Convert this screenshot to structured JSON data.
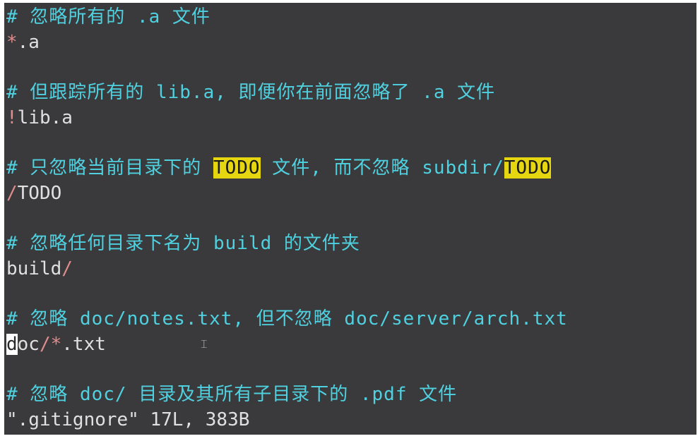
{
  "editor": {
    "lines": {
      "c1": "# 忽略所有的 .a 文件",
      "p1_op": "*",
      "p1_rest": ".a",
      "c2": "# 但跟踪所有的 lib.a, 即便你在前面忽略了 .a 文件",
      "p2_op": "!",
      "p2_rest": "lib.a",
      "c3_a": "# 只忽略当前目录下的 ",
      "c3_hl1": "TODO",
      "c3_b": " 文件, 而不忽略 subdir/",
      "c3_hl2": "TODO",
      "p3_op": "/",
      "p3_rest": "TODO",
      "c4": "# 忽略任何目录下名为 build 的文件夹",
      "p4_rest": "build",
      "p4_op": "/",
      "c5": "# 忽略 doc/notes.txt, 但不忽略 doc/server/arch.txt",
      "p5_cursor": "d",
      "p5_a": "oc",
      "p5_op": "/*",
      "p5_b": ".txt",
      "c6": "# 忽略 doc/ 目录及其所有子目录下的 .pdf 文件",
      "status": "\".gitignore\" 17L, 383B"
    },
    "ibeam": "⌶"
  },
  "colors": {
    "background": "#3a3a3c",
    "comment": "#4fd1e0",
    "text": "#e0e0e0",
    "operator": "#e08c8c",
    "highlight": "#e6d610"
  }
}
